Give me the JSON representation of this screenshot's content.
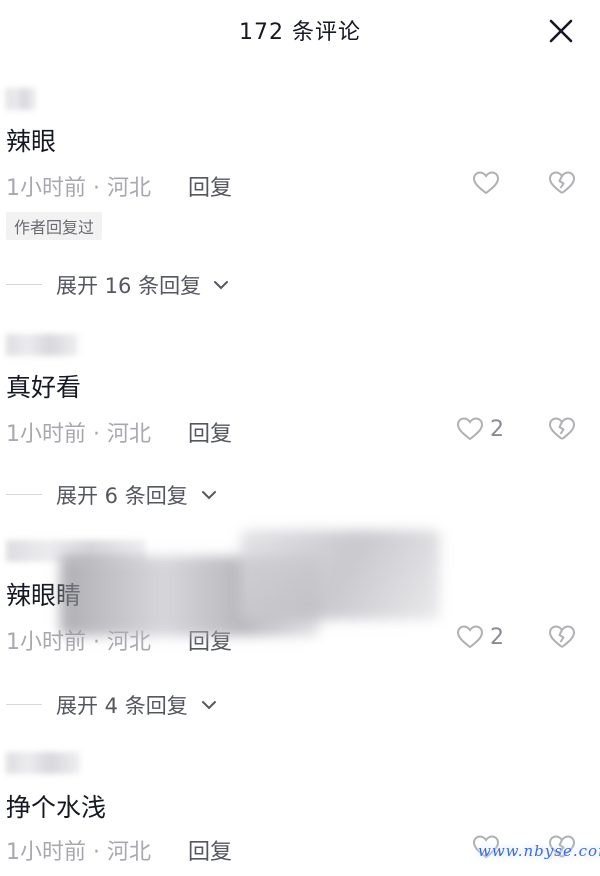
{
  "header": {
    "title": "172 条评论",
    "close_icon": "close-icon"
  },
  "comments": [
    {
      "text": "辣眼",
      "meta": "1小时前 · 河北",
      "reply_label": "回复",
      "like_count": "",
      "badge": "作者回复过",
      "expand_label": "展开 16 条回复"
    },
    {
      "text": "真好看",
      "meta": "1小时前 · 河北",
      "reply_label": "回复",
      "like_count": "2",
      "expand_label": "展开 6 条回复"
    },
    {
      "text": "辣眼睛",
      "meta": "1小时前 · 河北",
      "reply_label": "回复",
      "like_count": "2",
      "expand_label": "展开 4 条回复"
    },
    {
      "text": "挣个水浅",
      "meta": "1小时前 · 河北",
      "reply_label": "回复",
      "like_count": ""
    }
  ],
  "watermark": "www.nbyse.com",
  "colors": {
    "text": "#161823",
    "meta": "#a8a8ae",
    "icon": "#b0b0b5"
  }
}
